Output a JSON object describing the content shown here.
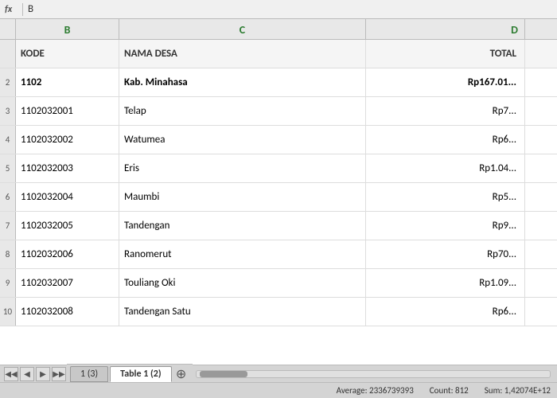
{
  "formula_bar": {
    "icon": "fx",
    "value": "B"
  },
  "columns": {
    "b_label": "B",
    "c_label": "C",
    "d_label": "D"
  },
  "header_row": {
    "b": "KODE",
    "c": "NAMA DESA",
    "d": "TOTAL"
  },
  "rows": [
    {
      "b": "1102",
      "c": "Kab.  Minahasa",
      "d": "Rp167.01...",
      "bold": true
    },
    {
      "b": "1102032001",
      "c": "Telap",
      "d": "Rp7..."
    },
    {
      "b": "1102032002",
      "c": "Watumea",
      "d": "Rp6..."
    },
    {
      "b": "1102032003",
      "c": "Eris",
      "d": "Rp1.04..."
    },
    {
      "b": "1102032004",
      "c": "Maumbi",
      "d": "Rp5..."
    },
    {
      "b": "1102032005",
      "c": "Tandengan",
      "d": "Rp9..."
    },
    {
      "b": "1102032006",
      "c": "Ranomerut",
      "d": "Rp70..."
    },
    {
      "b": "1102032007",
      "c": "Touliang  Oki",
      "d": "Rp1.09..."
    },
    {
      "b": "1102032008",
      "c": "Tandengan Satu",
      "d": "Rp6..."
    }
  ],
  "tabs": [
    {
      "label": "1 (3)",
      "active": false
    },
    {
      "label": "Table 1 (2)",
      "active": true
    }
  ],
  "status": {
    "average": "Average: 2336739393",
    "count": "Count: 812",
    "sum": "Sum: 1,42074E+12"
  }
}
